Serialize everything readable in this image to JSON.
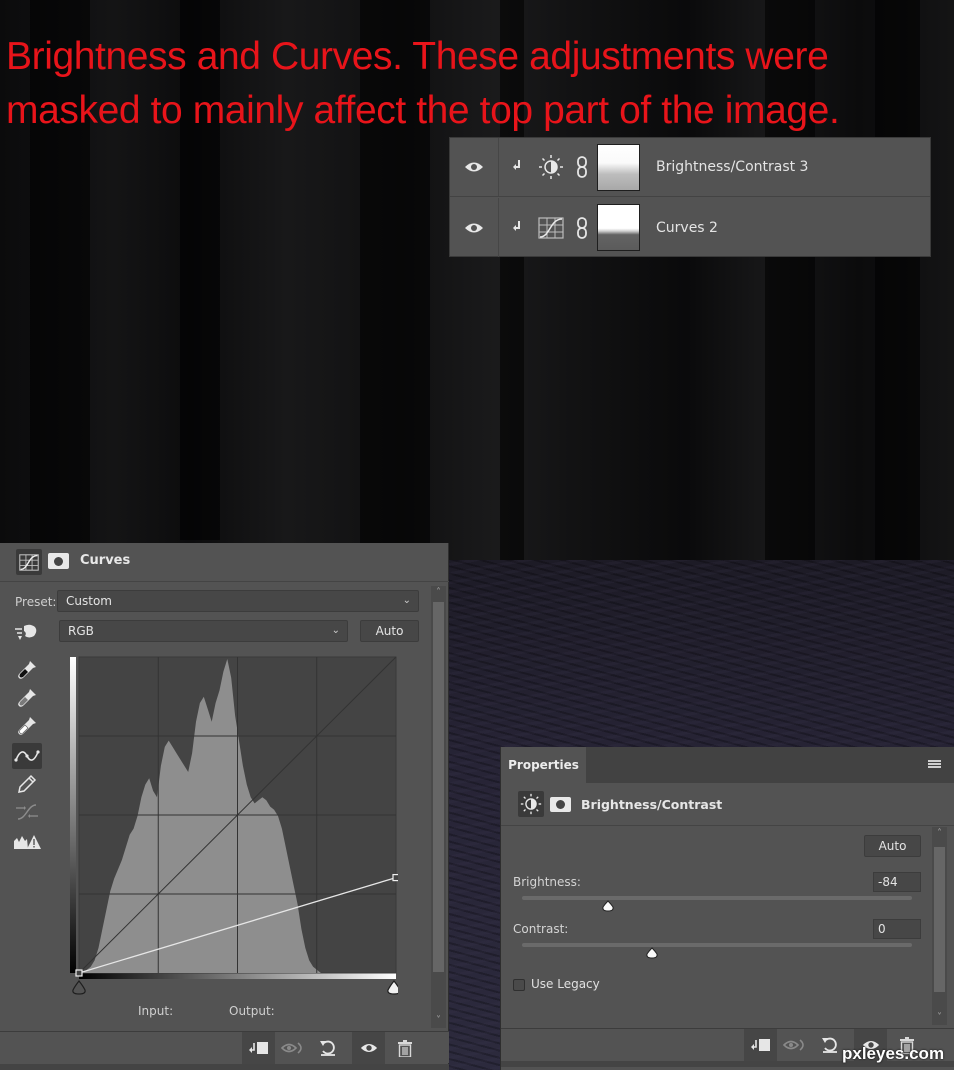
{
  "caption": {
    "line1": "Brightness and Curves.  These adjustments were",
    "line2": "masked to mainly affect the top part of the image.",
    "color": "#e8141a"
  },
  "layers_panel": {
    "layers": [
      {
        "name": "Brightness/Contrast 3",
        "visible": true,
        "clipped": true,
        "adjustment_icon": "brightness-contrast-icon",
        "linked": true
      },
      {
        "name": "Curves 2",
        "visible": true,
        "clipped": true,
        "adjustment_icon": "curves-icon",
        "linked": true
      }
    ]
  },
  "curves_panel": {
    "title": "Curves",
    "preset_label": "Preset:",
    "preset_value": "Custom",
    "channel_value": "RGB",
    "auto_label": "Auto",
    "input_label": "Input:",
    "output_label": "Output:",
    "tools": [
      "black-point-eyedropper-icon",
      "gray-point-eyedropper-icon",
      "white-point-eyedropper-icon",
      "edit-points-curve-icon",
      "pencil-draw-icon",
      "smooth-curve-icon",
      "clipping-warning-icon"
    ],
    "active_tool": "edit-points-curve-icon",
    "curve_points": [
      [
        0,
        0
      ],
      [
        255,
        77
      ]
    ],
    "input_range": [
      0,
      255
    ],
    "output_range": [
      0,
      255
    ],
    "footer_buttons": [
      "clip-to-layer",
      "view-previous-state",
      "reset-defaults",
      "toggle-visibility",
      "delete-adjustment"
    ]
  },
  "properties_panel": {
    "tab_label": "Properties",
    "title": "Brightness/Contrast",
    "auto_label": "Auto",
    "brightness_label": "Brightness:",
    "brightness_value": "-84",
    "brightness_range": [
      -150,
      150
    ],
    "contrast_label": "Contrast:",
    "contrast_value": "0",
    "contrast_range": [
      -50,
      100
    ],
    "use_legacy_label": "Use Legacy",
    "use_legacy_checked": false,
    "footer_buttons": [
      "clip-to-layer",
      "view-previous-state",
      "reset-defaults",
      "toggle-visibility",
      "delete-adjustment"
    ]
  },
  "watermark": "pxleyes.com"
}
